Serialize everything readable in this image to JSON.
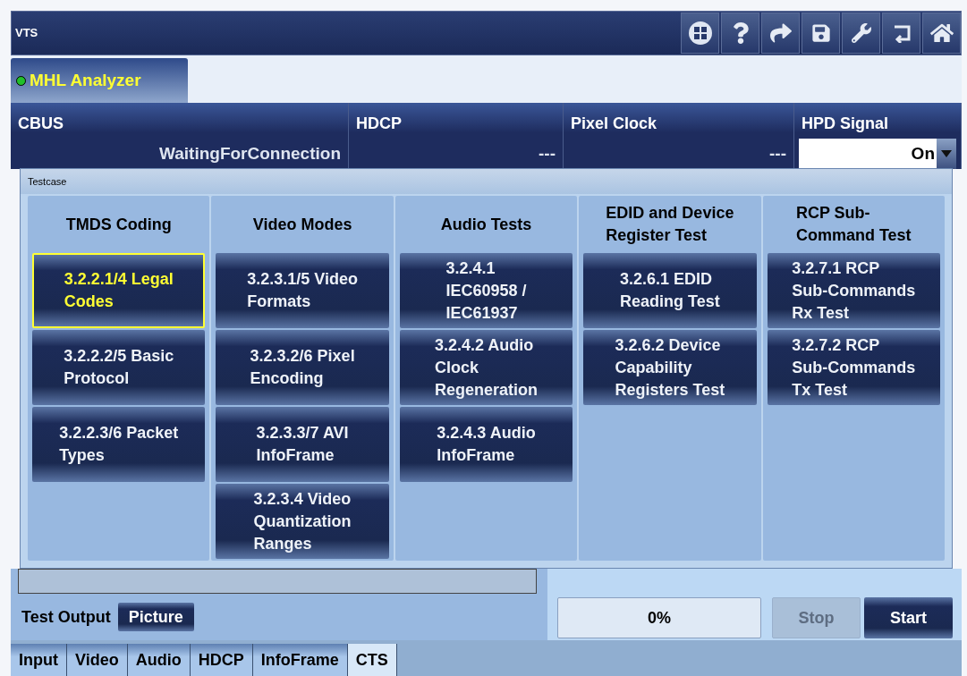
{
  "window": {
    "title": "VTS"
  },
  "module_tab": {
    "label": "MHL Analyzer",
    "selected": true
  },
  "status": [
    {
      "label": "CBUS",
      "value": "WaitingForConnection",
      "kind": "reading"
    },
    {
      "label": "HDCP",
      "value": "---",
      "kind": "reading"
    },
    {
      "label": "Pixel Clock",
      "value": "---",
      "kind": "reading"
    },
    {
      "label": "HPD Signal",
      "value": "On",
      "kind": "dropdown"
    }
  ],
  "testcase": {
    "title": "Testcase",
    "columns": [
      {
        "heading": "TMDS Coding",
        "tests": [
          {
            "label": "3.2.2.1/4 Legal\nCodes",
            "selected": true
          },
          {
            "label": "3.2.2.2/5 Basic\nProtocol",
            "selected": false
          },
          {
            "label": "3.2.2.3/6 Packet\nTypes",
            "selected": false
          }
        ]
      },
      {
        "heading": "Video Modes",
        "tests": [
          {
            "label": "3.2.3.1/5 Video\nFormats",
            "selected": false
          },
          {
            "label": "3.2.3.2/6 Pixel\nEncoding",
            "selected": false
          },
          {
            "label": "3.2.3.3/7 AVI\nInfoFrame",
            "selected": false
          },
          {
            "label": "3.2.3.4 Video\nQuantization\nRanges",
            "selected": false
          }
        ]
      },
      {
        "heading": "Audio Tests",
        "tests": [
          {
            "label": "3.2.4.1\nIEC60958 /\nIEC61937",
            "selected": false
          },
          {
            "label": "3.2.4.2 Audio\nClock\nRegeneration",
            "selected": false
          },
          {
            "label": "3.2.4.3 Audio\nInfoFrame",
            "selected": false
          }
        ]
      },
      {
        "heading": "EDID and Device\nRegister Test",
        "tests": [
          {
            "label": "3.2.6.1 EDID\nReading Test",
            "selected": false
          },
          {
            "label": "3.2.6.2 Device\nCapability\nRegisters Test",
            "selected": false
          }
        ]
      },
      {
        "heading": "RCP Sub-\nCommand Test",
        "tests": [
          {
            "label": "3.2.7.1 RCP\nSub-Commands\nRx Test",
            "selected": false
          },
          {
            "label": "3.2.7.2 RCP\nSub-Commands\nTx Test",
            "selected": false
          }
        ]
      }
    ]
  },
  "test_output": {
    "label": "Test Output",
    "value": "Picture"
  },
  "progress": {
    "label": "0%",
    "level": 0
  },
  "buttons": [
    {
      "label": "Stop",
      "disabled": true
    },
    {
      "label": "Start",
      "disabled": false
    }
  ],
  "tabs": [
    {
      "label": "Input",
      "selected": false
    },
    {
      "label": "Video",
      "selected": false
    },
    {
      "label": "Audio",
      "selected": false
    },
    {
      "label": "HDCP",
      "selected": false
    },
    {
      "label": "InfoFrame",
      "selected": false
    },
    {
      "label": "CTS",
      "selected": true
    }
  ]
}
